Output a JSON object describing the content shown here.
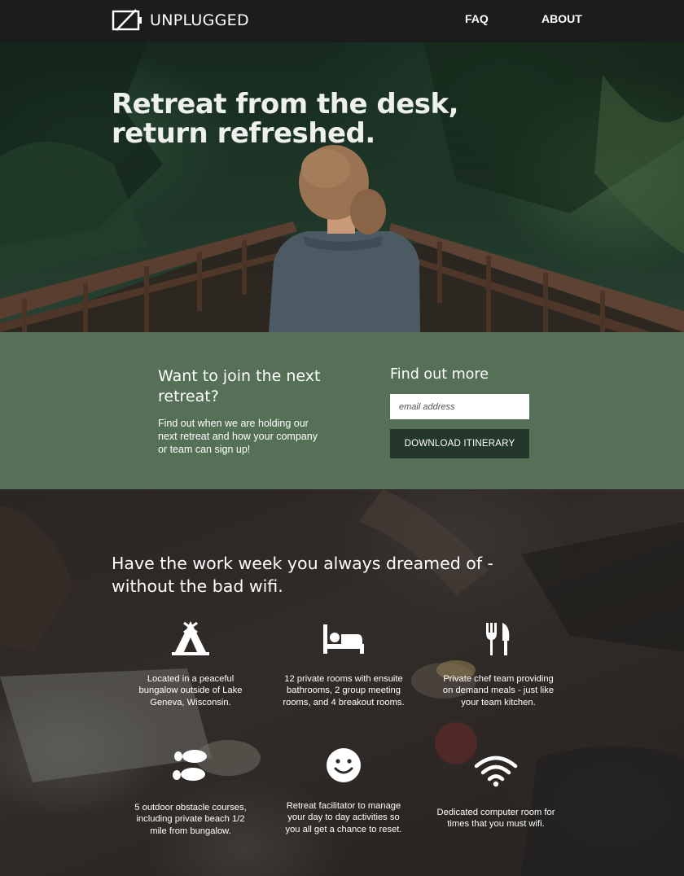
{
  "nav": {
    "brand": "UNPLUGGED",
    "links": [
      "FAQ",
      "ABOUT"
    ]
  },
  "hero": {
    "title": "Retreat from the desk, return refreshed."
  },
  "signup": {
    "title": "Want to join the next retreat?",
    "description": "Find out when we are holding our next retreat and how your company or team can sign up!",
    "find_title": "Find out more",
    "email_placeholder": "email address",
    "button_label": "DOWNLOAD ITINERARY"
  },
  "features": {
    "title": "Have the work week you always dreamed of - without the bad wifi.",
    "items": [
      {
        "icon": "tent-icon",
        "text": "Located in a peaceful bungalow outside of Lake Geneva, Wisconsin."
      },
      {
        "icon": "bed-icon",
        "text": "12 private rooms with ensuite bathrooms, 2 group meeting rooms, and 4 breakout rooms."
      },
      {
        "icon": "utensils-icon",
        "text": "Private chef team providing on demand meals - just like your team kitchen."
      },
      {
        "icon": "footprints-icon",
        "text": "5 outdoor obstacle courses, including private beach 1/2 mile from bungalow."
      },
      {
        "icon": "smile-icon",
        "text": "Retreat facilitator to manage your day to day activities so you all get a chance to reset."
      },
      {
        "icon": "wifi-icon",
        "text": "Dedicated computer room for times that you must wifi."
      }
    ]
  },
  "colors": {
    "nav_bg": "#1c1c1c",
    "signup_bg": "#557057",
    "button_bg": "#25362b",
    "text": "#ffffff"
  }
}
